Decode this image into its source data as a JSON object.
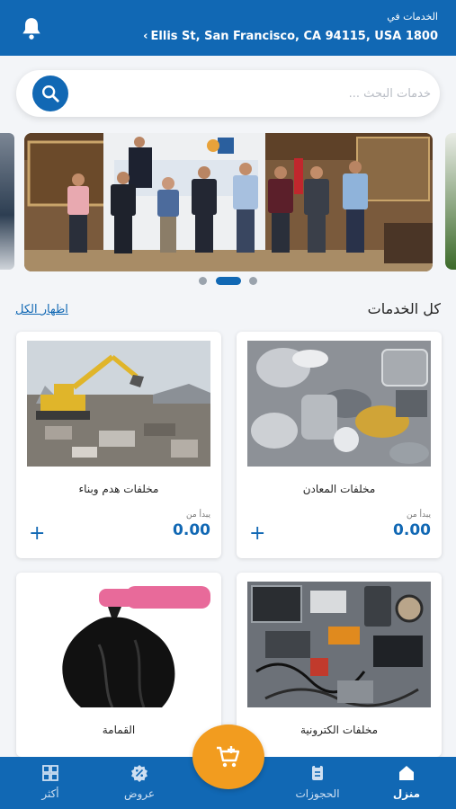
{
  "header": {
    "location_caption": "الخدمات في",
    "location_address": "Ellis St, San Francisco, CA 94115, USA 1800"
  },
  "search": {
    "placeholder": "خدمات البحث ..."
  },
  "carousel": {
    "slide_count": 3,
    "active_index": 1
  },
  "section": {
    "title": "كل الخدمات",
    "show_all": "اظهار الكل"
  },
  "services": [
    {
      "name": "مخلفات المعادن",
      "starts_from": "يبدأ من",
      "price": "0.00"
    },
    {
      "name": "مخلفات هدم وبناء",
      "starts_from": "يبدأ من",
      "price": "0.00"
    },
    {
      "name": "مخلفات الكترونية"
    },
    {
      "name": "القمامة"
    }
  ],
  "bottom_nav": [
    {
      "label": "منزل",
      "icon": "home-icon",
      "active": true
    },
    {
      "label": "الحجوزات",
      "icon": "bookings-icon",
      "active": false
    },
    {
      "label": "عروض",
      "icon": "offers-icon",
      "active": false
    },
    {
      "label": "أكثر",
      "icon": "grid-icon",
      "active": false
    }
  ],
  "colors": {
    "primary": "#1168b4",
    "accent": "#f29c1f",
    "background": "#f3f5f8"
  }
}
